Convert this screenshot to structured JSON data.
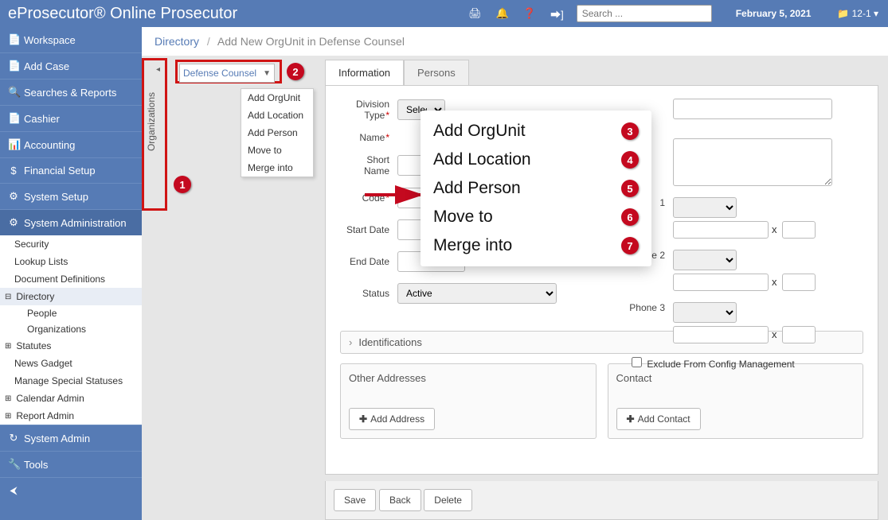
{
  "header": {
    "brand": "eProsecutor® Online Prosecutor",
    "search_placeholder": "Search ...",
    "date": "February 5, 2021",
    "right_label": "12-1",
    "right_caret": "▾"
  },
  "sidebar": {
    "items": [
      {
        "label": "Workspace",
        "icon": "📄"
      },
      {
        "label": "Add Case",
        "icon": "📄"
      },
      {
        "label": "Searches & Reports",
        "icon": "🔍"
      },
      {
        "label": "Cashier",
        "icon": "📄"
      },
      {
        "label": "Accounting",
        "icon": "📊"
      },
      {
        "label": "Financial Setup",
        "icon": "$"
      },
      {
        "label": "System Setup",
        "icon": "⚙"
      },
      {
        "label": "System Administration",
        "icon": "⚙"
      }
    ],
    "admin_tree": {
      "security": "Security",
      "lookup": "Lookup Lists",
      "docdef": "Document Definitions",
      "directory": "Directory",
      "people": "People",
      "organizations": "Organizations",
      "statutes": "Statutes",
      "news": "News Gadget",
      "msp": "Manage Special Statuses",
      "caladmin": "Calendar Admin",
      "repadmin": "Report Admin"
    },
    "tail": [
      {
        "label": "System Admin",
        "icon": "↻"
      },
      {
        "label": "Tools",
        "icon": "🔧"
      },
      {
        "label": "",
        "icon": "⮜"
      }
    ]
  },
  "breadcrumb": {
    "root": "Directory",
    "current": "Add New OrgUnit in Defense Counsel"
  },
  "org_panel": {
    "label": "Organizations",
    "dropdown": "Defense Counsel"
  },
  "context_menu": [
    "Add OrgUnit",
    "Add Location",
    "Add Person",
    "Move to",
    "Merge into"
  ],
  "tabs": {
    "info": "Information",
    "persons": "Persons"
  },
  "form": {
    "division_type": "Division Type",
    "division_select": "Select",
    "name": "Name",
    "short_name": "Short Name",
    "code": "Code",
    "start_date": "Start Date",
    "end_date": "End Date",
    "status": "Status",
    "status_value": "Active",
    "phone1": "1",
    "phone2": "Phone 2",
    "phone3": "Phone 3",
    "x": "x",
    "exclude": "Exclude From Config Management",
    "identifications": "Identifications",
    "other_addr": "Other Addresses",
    "add_addr": "Add Address",
    "contact": "Contact",
    "add_contact": "Add Contact"
  },
  "actions": {
    "save": "Save",
    "back": "Back",
    "delete": "Delete"
  },
  "callouts": {
    "c1": "1",
    "c2": "2",
    "c3": "3",
    "c4": "4",
    "c5": "5",
    "c6": "6",
    "c7": "7",
    "pop": [
      "Add OrgUnit",
      "Add Location",
      "Add Person",
      "Move to",
      "Merge into"
    ]
  }
}
